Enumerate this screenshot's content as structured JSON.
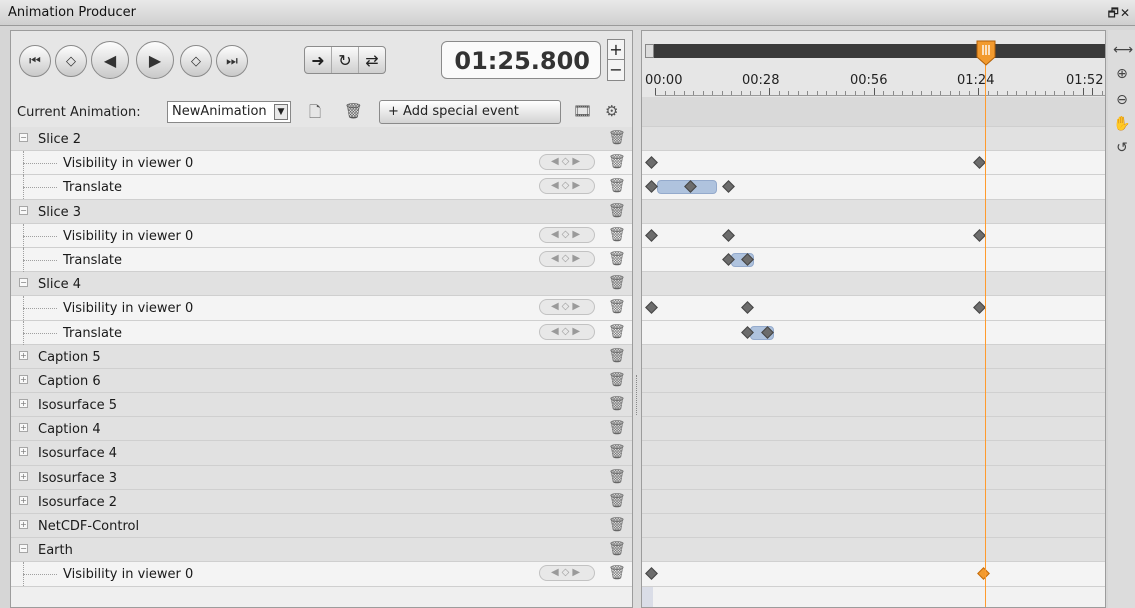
{
  "window": {
    "title": "Animation Producer"
  },
  "transport": {
    "time": "01:25.800",
    "spin_up": "+",
    "spin_down": "−"
  },
  "animation_bar": {
    "label": "Current Animation:",
    "current_animation": "NewAnimation",
    "add_event_label": "+ Add special event"
  },
  "timeline": {
    "ticks": [
      "00:00",
      "00:28",
      "00:56",
      "01:24",
      "01:52"
    ],
    "cursor_time": "01:25.800"
  },
  "tracks": [
    {
      "type": "group",
      "label": "Slice 2",
      "expanded": true
    },
    {
      "type": "child",
      "label": "Visibility in viewer 0"
    },
    {
      "type": "child",
      "label": "Translate"
    },
    {
      "type": "group",
      "label": "Slice 3",
      "expanded": true
    },
    {
      "type": "child",
      "label": "Visibility in viewer 0"
    },
    {
      "type": "child",
      "label": "Translate"
    },
    {
      "type": "group",
      "label": "Slice 4",
      "expanded": true
    },
    {
      "type": "child",
      "label": "Visibility in viewer 0"
    },
    {
      "type": "child",
      "label": "Translate"
    },
    {
      "type": "group",
      "label": "Caption 5",
      "expanded": false
    },
    {
      "type": "group",
      "label": "Caption 6",
      "expanded": false
    },
    {
      "type": "group",
      "label": "Isosurface 5",
      "expanded": false
    },
    {
      "type": "group",
      "label": "Caption 4",
      "expanded": false
    },
    {
      "type": "group",
      "label": "Isosurface 4",
      "expanded": false
    },
    {
      "type": "group",
      "label": "Isosurface 3",
      "expanded": false
    },
    {
      "type": "group",
      "label": "Isosurface 2",
      "expanded": false
    },
    {
      "type": "group",
      "label": "NetCDF-Control",
      "expanded": false
    },
    {
      "type": "group",
      "label": "Earth",
      "expanded": true
    },
    {
      "type": "child",
      "label": "Visibility in viewer 0"
    }
  ]
}
